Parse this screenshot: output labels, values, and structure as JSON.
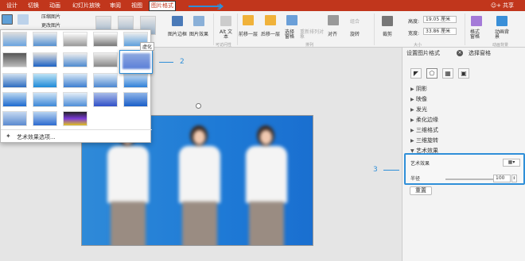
{
  "tabs": [
    "设计",
    "切换",
    "动画",
    "幻灯片放映",
    "审阅",
    "视图",
    "图片格式"
  ],
  "share_label": "共享",
  "ribbon": {
    "compress": "压缩图片",
    "change_pic": "更改图片",
    "border": "图片边框",
    "effects": "图片效果",
    "alt_text": "Alt 文本",
    "accessibility_group": "可访问性",
    "bring_forward": "前移一层",
    "send_backward": "后移一层",
    "selection_pane": "选择窗格",
    "reorder_objects": "重新排列对象",
    "align": "对齐",
    "group": "组合",
    "rotate": "旋转",
    "arrange_group": "排列",
    "crop": "裁剪",
    "height_label": "高度:",
    "height_value": "19.05 厘米",
    "width_label": "宽度:",
    "width_value": "33.86 厘米",
    "size_group": "大小",
    "format_pane": "格式窗格",
    "animate_bg": "动画背景",
    "anim_group": "动画背景"
  },
  "gallery": {
    "tooltip": "虚化",
    "footer": "艺术效果选项..."
  },
  "annotations": {
    "n1": "1",
    "n2": "2",
    "n3": "3"
  },
  "pane": {
    "title": "设置图片格式",
    "selection_tab": "选择窗格",
    "sections": [
      "阴影",
      "映像",
      "发光",
      "柔化边缘",
      "三维格式",
      "三维旋转",
      "艺术效果"
    ],
    "art_effect_label": "艺术效果",
    "radius_label": "半径",
    "radius_value": "100",
    "reset": "重置"
  },
  "colors": {
    "accent": "#c1361c",
    "highlight": "#2f8fd8",
    "slide_bg": "#1e7ad6"
  }
}
